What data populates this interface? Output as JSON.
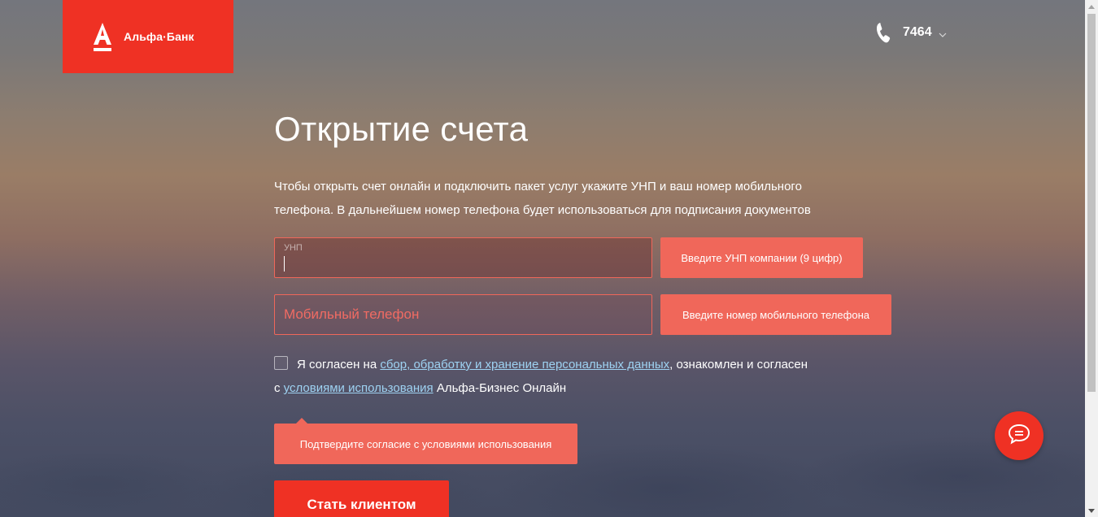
{
  "brand": {
    "name": "Альфа·Банк",
    "color": "#ef3124"
  },
  "header": {
    "phone_number": "7464",
    "phone_icon": "phone-icon",
    "chevron_icon": "chevron-down-icon"
  },
  "main": {
    "title": "Открытие счета",
    "lead": "Чтобы открыть счет онлайн и подключить пакет услуг укажите УНП и ваш номер мобильного телефона. В дальнейшем номер телефона будет использоваться для подписания документов",
    "unp_field": {
      "label": "УНП",
      "value": "",
      "hint": "Введите УНП компании (9 цифр)"
    },
    "phone_field": {
      "placeholder": "Мобильный телефон",
      "value": "",
      "hint": "Введите номер мобильного телефона"
    },
    "consent": {
      "checked": false,
      "text_before": "Я согласен на ",
      "link_personal_data": "сбор, обработку и хранение персональных данных",
      "text_middle": ", ознакомлен и согласен",
      "text_c": "с ",
      "link_terms": "условиями использования",
      "text_after": " Альфа-Бизнес Онлайн",
      "hint": "Подтвердите согласие с условиями использования"
    },
    "submit_label": "Стать клиентом"
  },
  "chat": {
    "icon": "chat-icon"
  },
  "colors": {
    "accent": "#ef3124",
    "error_tip": "#f0675a",
    "link": "#9ed2f2"
  }
}
